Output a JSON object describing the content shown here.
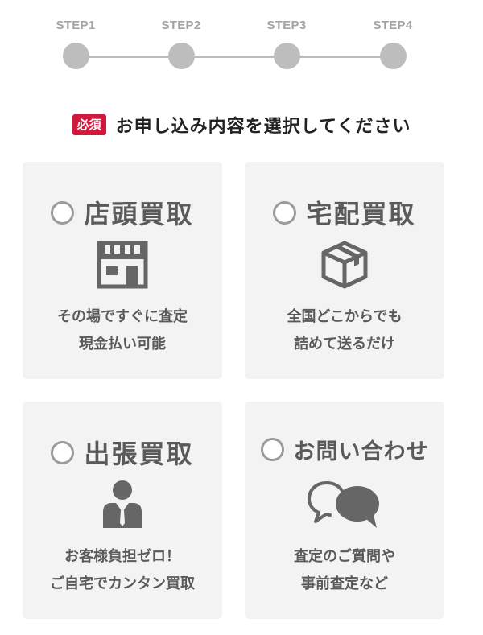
{
  "steps": [
    {
      "label": "STEP1"
    },
    {
      "label": "STEP2"
    },
    {
      "label": "STEP3"
    },
    {
      "label": "STEP4"
    }
  ],
  "heading": {
    "required_badge": "必須",
    "text": "お申し込み内容を選択してください"
  },
  "options": [
    {
      "title": "店頭買取",
      "icon": "store-icon",
      "desc_line1": "その場ですぐに査定",
      "desc_line2": "現金払い可能"
    },
    {
      "title": "宅配買取",
      "icon": "package-box-icon",
      "desc_line1": "全国どこからでも",
      "desc_line2": "詰めて送るだけ"
    },
    {
      "title": "出張買取",
      "icon": "person-icon",
      "desc_line1": "お客様負担ゼロ！",
      "desc_line2": "ご自宅でカンタン買取"
    },
    {
      "title": "お問い合わせ",
      "icon": "chat-bubbles-icon",
      "desc_line1": "査定のご質問や",
      "desc_line2": "事前査定など"
    }
  ],
  "colors": {
    "badge": "#d3183e",
    "step_inactive": "#bdbdbd",
    "card_background": "#f3f3f3",
    "icon": "#666666"
  }
}
